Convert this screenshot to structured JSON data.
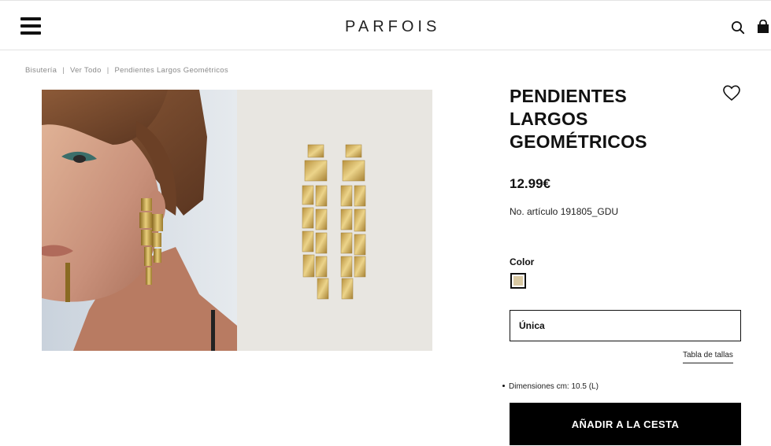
{
  "header": {
    "logo": "PARFOIS",
    "menu_icon": "hamburger-menu-icon",
    "search_icon": "search-icon",
    "cart_icon": "shopping-bag-icon"
  },
  "breadcrumb": {
    "items": [
      "Bisutería",
      "Ver Todo",
      "Pendientes Largos Geométricos"
    ],
    "separator": "|"
  },
  "product": {
    "title": "PENDIENTES LARGOS GEOMÉTRICOS",
    "price": "12.99€",
    "article_number": "No. artículo 191805_GDU",
    "wishlist_icon": "heart-icon",
    "color_label": "Color",
    "swatch_color": "#d9c9a3",
    "size_value": "Única",
    "size_table_label": "Tabla de tallas",
    "dimensions": "Dimensiones cm: 10.5 (L)",
    "add_to_cart_label": "AÑADIR A LA CESTA"
  },
  "colors": {
    "primary": "#000000",
    "text": "#111111",
    "muted": "#8a8a8a",
    "product_bg": "#e8e6e1",
    "gold": "#c9a24c"
  }
}
